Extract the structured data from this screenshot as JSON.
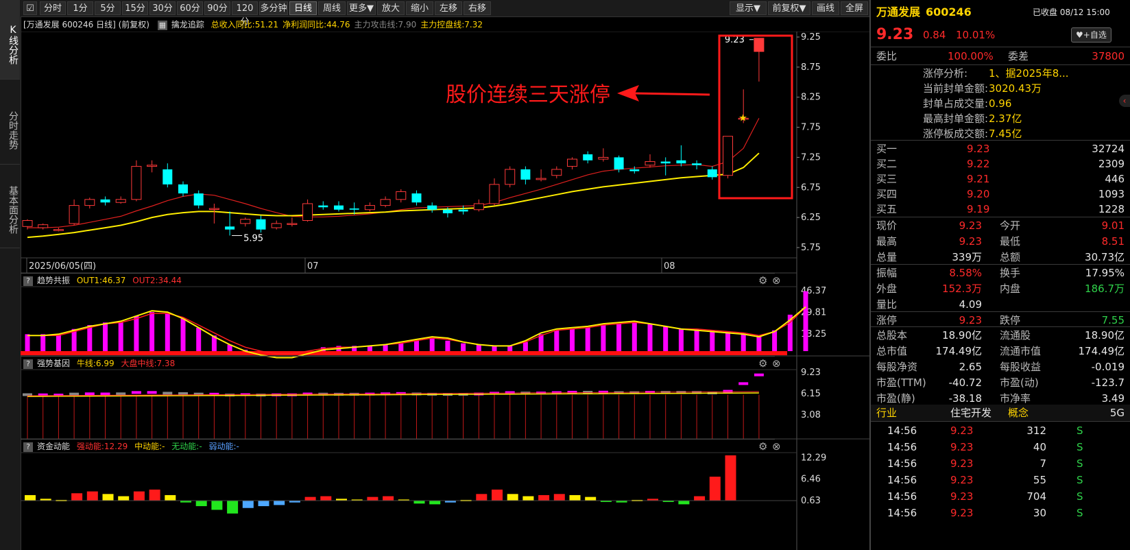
{
  "left_tabs": [
    "K线分析",
    "分时走势",
    "基本面分析"
  ],
  "toolbar": {
    "left_buttons": [
      "分时",
      "1分",
      "5分",
      "15分",
      "30分",
      "60分",
      "90分",
      "120分",
      "多分钟",
      "日线",
      "周线",
      "更多▼",
      "放大",
      "缩小",
      "左移",
      "右移"
    ],
    "active": "日线",
    "right_buttons": [
      "显示▼",
      "前复权▼",
      "画线",
      "全屏"
    ]
  },
  "info": {
    "title": "[万通发展 600246 日线] (前复权)",
    "indicator": "擒龙追踪",
    "items": [
      {
        "text": "总收入同比:51.21",
        "color": "#ffd400"
      },
      {
        "text": "净利润同比:44.76",
        "color": "#ffd400"
      },
      {
        "text": "主力攻击线:7.90",
        "color": "#888888"
      },
      {
        "text": "主力控盘线:7.32",
        "color": "#ffd400"
      }
    ]
  },
  "kchart": {
    "price_ticks": [
      "9.25",
      "8.75",
      "8.25",
      "7.75",
      "7.25",
      "6.75",
      "6.25",
      "5.75"
    ],
    "date_labels": [
      "2025/06/05(四)",
      "07",
      "08"
    ],
    "high_label": "9.23",
    "low_label": "5.95",
    "annotation": "股价连续三天涨停",
    "candles": [
      {
        "o": 6.1,
        "c": 6.2,
        "h": 6.22,
        "l": 6.05
      },
      {
        "o": 6.08,
        "c": 6.13,
        "h": 6.15,
        "l": 6.05
      },
      {
        "o": 6.05,
        "c": 6.05,
        "h": 6.08,
        "l": 6.02
      },
      {
        "o": 6.15,
        "c": 6.45,
        "h": 6.55,
        "l": 6.12
      },
      {
        "o": 6.45,
        "c": 6.55,
        "h": 6.58,
        "l": 6.4
      },
      {
        "o": 6.55,
        "c": 6.5,
        "h": 6.6,
        "l": 6.45
      },
      {
        "o": 6.5,
        "c": 6.55,
        "h": 6.6,
        "l": 6.48
      },
      {
        "o": 6.55,
        "c": 7.1,
        "h": 7.2,
        "l": 6.52
      },
      {
        "o": 7.1,
        "c": 7.12,
        "h": 7.2,
        "l": 7.0
      },
      {
        "o": 7.05,
        "c": 6.8,
        "h": 7.15,
        "l": 6.75
      },
      {
        "o": 6.8,
        "c": 6.65,
        "h": 6.85,
        "l": 6.6
      },
      {
        "o": 6.65,
        "c": 6.45,
        "h": 6.7,
        "l": 6.4
      },
      {
        "o": 6.4,
        "c": 6.4,
        "h": 6.48,
        "l": 6.15
      },
      {
        "o": 6.1,
        "c": 6.05,
        "h": 6.35,
        "l": 5.95
      },
      {
        "o": 6.15,
        "c": 6.22,
        "h": 6.25,
        "l": 6.1
      },
      {
        "o": 6.22,
        "c": 6.05,
        "h": 6.28,
        "l": 6.0
      },
      {
        "o": 6.08,
        "c": 6.15,
        "h": 6.2,
        "l": 6.05
      },
      {
        "o": 6.15,
        "c": 6.15,
        "h": 6.25,
        "l": 6.1
      },
      {
        "o": 6.2,
        "c": 6.48,
        "h": 6.55,
        "l": 6.18
      },
      {
        "o": 6.45,
        "c": 6.42,
        "h": 6.52,
        "l": 6.38
      },
      {
        "o": 6.45,
        "c": 6.38,
        "h": 6.52,
        "l": 6.35
      },
      {
        "o": 6.4,
        "c": 6.38,
        "h": 6.5,
        "l": 6.3
      },
      {
        "o": 6.38,
        "c": 6.45,
        "h": 6.5,
        "l": 6.35
      },
      {
        "o": 6.45,
        "c": 6.55,
        "h": 6.6,
        "l": 6.42
      },
      {
        "o": 6.55,
        "c": 6.68,
        "h": 6.72,
        "l": 6.5
      },
      {
        "o": 6.65,
        "c": 6.5,
        "h": 6.7,
        "l": 6.45
      },
      {
        "o": 6.45,
        "c": 6.38,
        "h": 6.5,
        "l": 6.33
      },
      {
        "o": 6.38,
        "c": 6.32,
        "h": 6.42,
        "l": 6.25
      },
      {
        "o": 6.38,
        "c": 6.35,
        "h": 6.45,
        "l": 6.3
      },
      {
        "o": 6.38,
        "c": 6.48,
        "h": 6.55,
        "l": 6.35
      },
      {
        "o": 6.48,
        "c": 6.8,
        "h": 6.9,
        "l": 6.45
      },
      {
        "o": 6.8,
        "c": 7.05,
        "h": 7.1,
        "l": 6.75
      },
      {
        "o": 7.05,
        "c": 6.88,
        "h": 7.1,
        "l": 6.8
      },
      {
        "o": 6.88,
        "c": 6.9,
        "h": 7.05,
        "l": 6.85
      },
      {
        "o": 6.95,
        "c": 7.05,
        "h": 7.1,
        "l": 6.9
      },
      {
        "o": 7.1,
        "c": 7.22,
        "h": 7.25,
        "l": 7.05
      },
      {
        "o": 7.3,
        "c": 7.2,
        "h": 7.35,
        "l": 7.15
      },
      {
        "o": 7.22,
        "c": 7.25,
        "h": 7.4,
        "l": 7.18
      },
      {
        "o": 7.25,
        "c": 7.05,
        "h": 7.28,
        "l": 7.0
      },
      {
        "o": 7.05,
        "c": 7.02,
        "h": 7.1,
        "l": 6.98
      },
      {
        "o": 7.12,
        "c": 7.18,
        "h": 7.3,
        "l": 7.08
      },
      {
        "o": 7.18,
        "c": 7.15,
        "h": 7.25,
        "l": 6.95
      },
      {
        "o": 7.2,
        "c": 7.15,
        "h": 7.45,
        "l": 7.1
      },
      {
        "o": 7.15,
        "c": 7.12,
        "h": 7.2,
        "l": 7.05
      },
      {
        "o": 7.05,
        "c": 6.92,
        "h": 7.1,
        "l": 6.88
      },
      {
        "o": 6.95,
        "c": 7.6,
        "h": 7.6,
        "l": 6.9
      },
      {
        "o": 7.9,
        "c": 7.9,
        "h": 8.38,
        "l": 7.82
      },
      {
        "o": 9.01,
        "c": 9.23,
        "h": 9.23,
        "l": 8.51
      }
    ],
    "ma_red": [
      6.08,
      6.08,
      6.09,
      6.12,
      6.17,
      6.22,
      6.27,
      6.36,
      6.44,
      6.53,
      6.6,
      6.64,
      6.62,
      6.55,
      6.48,
      6.4,
      6.33,
      6.27,
      6.26,
      6.26,
      6.27,
      6.29,
      6.31,
      6.34,
      6.38,
      6.41,
      6.42,
      6.43,
      6.44,
      6.45,
      6.5,
      6.58,
      6.65,
      6.72,
      6.8,
      6.88,
      6.96,
      7.02,
      7.05,
      7.07,
      7.09,
      7.11,
      7.12,
      7.13,
      7.1,
      7.18,
      7.4,
      7.9
    ],
    "ma_yellow": [
      5.92,
      5.94,
      5.97,
      6.0,
      6.04,
      6.08,
      6.12,
      6.18,
      6.25,
      6.3,
      6.33,
      6.35,
      6.35,
      6.33,
      6.31,
      6.29,
      6.28,
      6.28,
      6.29,
      6.3,
      6.31,
      6.32,
      6.33,
      6.34,
      6.36,
      6.37,
      6.38,
      6.39,
      6.4,
      6.41,
      6.44,
      6.48,
      6.53,
      6.58,
      6.63,
      6.68,
      6.72,
      6.76,
      6.79,
      6.82,
      6.85,
      6.88,
      6.91,
      6.93,
      6.95,
      6.97,
      7.08,
      7.32
    ]
  },
  "panel1": {
    "title": "趋势共振",
    "out1": "OUT1:46.37",
    "out2": "OUT2:34.44",
    "ticks": [
      "46.37",
      "29.81",
      "13.25"
    ],
    "bars": [
      13,
      13,
      13,
      17,
      20,
      22,
      22,
      27,
      30,
      29,
      25,
      18,
      12,
      5,
      1,
      0,
      0,
      0,
      0,
      3,
      4,
      4,
      4,
      5,
      6,
      8,
      10,
      8,
      6,
      5,
      4,
      4,
      7,
      13,
      16,
      17,
      18,
      20,
      21,
      22,
      21,
      19,
      17,
      17,
      16,
      15,
      14,
      12,
      16,
      28,
      46
    ],
    "line_yellow": [
      12,
      12,
      13,
      16,
      19,
      21,
      23,
      27,
      31,
      30,
      25,
      18,
      11,
      5,
      0,
      -3,
      -5,
      -5,
      -2,
      1,
      2,
      3,
      4,
      5,
      7,
      9,
      11,
      10,
      7,
      5,
      4,
      4,
      8,
      14,
      17,
      18,
      19,
      21,
      22,
      23,
      21,
      19,
      17,
      16,
      15,
      14,
      13,
      11,
      15,
      24,
      34
    ],
    "line_red": [
      12,
      12,
      12,
      15,
      18,
      21,
      22,
      25,
      29,
      29,
      26,
      20,
      14,
      8,
      3,
      0,
      -2,
      -2,
      0,
      2,
      3,
      3,
      4,
      5,
      6,
      8,
      10,
      9,
      7,
      5,
      4,
      4,
      7,
      12,
      16,
      17,
      18,
      20,
      21,
      22,
      21,
      19,
      17,
      17,
      16,
      15,
      14,
      12,
      15,
      22,
      34
    ]
  },
  "panel2": {
    "title": "强势基因",
    "niu": "牛线:6.99",
    "dapan": "大盘中线:7.38",
    "ticks": [
      "9.23",
      "6.15",
      "3.08"
    ]
  },
  "panel3": {
    "title": "资金动能",
    "strong": "强动能:12.29",
    "mid": "中动能:-",
    "none": "无动能:-",
    "weak": "弱动能:-",
    "ticks": [
      "12.29",
      "6.46",
      "0.63"
    ],
    "bars": [
      1.5,
      0.5,
      0.2,
      2.0,
      2.5,
      1.8,
      1.2,
      2.5,
      3.0,
      1.5,
      -0.5,
      -1.5,
      -2.5,
      -3.5,
      -2.0,
      -1.5,
      -1.2,
      -0.5,
      1.0,
      1.2,
      0.5,
      0.3,
      1.0,
      1.2,
      0.3,
      -0.8,
      -1.0,
      -0.5,
      0.2,
      1.8,
      3.0,
      1.8,
      1.2,
      1.5,
      1.8,
      1.5,
      1.0,
      -0.3,
      -0.5,
      0.2,
      0.5,
      -0.3,
      -1.0,
      1.2,
      6.5,
      12.29
    ],
    "bar_colors": [
      "y",
      "y",
      "y",
      "r",
      "r",
      "y",
      "y",
      "r",
      "r",
      "y",
      "g",
      "g",
      "g",
      "g",
      "b",
      "b",
      "b",
      "b",
      "r",
      "r",
      "y",
      "y",
      "r",
      "r",
      "y",
      "g",
      "g",
      "b",
      "y",
      "r",
      "r",
      "y",
      "y",
      "r",
      "r",
      "y",
      "y",
      "g",
      "g",
      "y",
      "r",
      "g",
      "g",
      "r",
      "r",
      "r"
    ]
  },
  "quote": {
    "name": "万通发展",
    "code": "600246",
    "status": "已收盘 08/12 15:00",
    "price": "9.23",
    "change": "0.84",
    "pct": "10.01%",
    "watch_btn": "+自选",
    "weibi_label": "委比",
    "weibi": "100.00%",
    "weicha_label": "委差",
    "weicha": "37800",
    "limit_analysis": [
      {
        "label": "涨停分析:",
        "value": "1、据2025年8..."
      },
      {
        "label": "当前封单金额:",
        "value": "3020.43万"
      },
      {
        "label": "封单占成交量:",
        "value": "0.96"
      },
      {
        "label": "最高封单金额:",
        "value": "2.37亿"
      },
      {
        "label": "涨停板成交额:",
        "value": "7.45亿"
      }
    ],
    "bids": [
      {
        "label": "买一",
        "price": "9.23",
        "vol": "32724"
      },
      {
        "label": "买二",
        "price": "9.22",
        "vol": "2309"
      },
      {
        "label": "买三",
        "price": "9.21",
        "vol": "446"
      },
      {
        "label": "买四",
        "price": "9.20",
        "vol": "1093"
      },
      {
        "label": "买五",
        "price": "9.19",
        "vol": "1228"
      }
    ],
    "stats": [
      {
        "l1": "现价",
        "v1": "9.23",
        "c1": "red",
        "l2": "今开",
        "v2": "9.01",
        "c2": "red"
      },
      {
        "l1": "最高",
        "v1": "9.23",
        "c1": "red",
        "l2": "最低",
        "v2": "8.51",
        "c2": "red"
      },
      {
        "l1": "总量",
        "v1": "339万",
        "c1": "wht",
        "l2": "总额",
        "v2": "30.73亿",
        "c2": "wht"
      },
      {
        "l1": "振幅",
        "v1": "8.58%",
        "c1": "red",
        "l2": "换手",
        "v2": "17.95%",
        "c2": "wht"
      },
      {
        "l1": "外盘",
        "v1": "152.3万",
        "c1": "red",
        "l2": "内盘",
        "v2": "186.7万",
        "c2": "grn"
      },
      {
        "l1": "量比",
        "v1": "4.09",
        "c1": "wht",
        "l2": "",
        "v2": "",
        "c2": "wht"
      },
      {
        "l1": "涨停",
        "v1": "9.23",
        "c1": "red",
        "l2": "跌停",
        "v2": "7.55",
        "c2": "grn"
      },
      {
        "l1": "总股本",
        "v1": "18.90亿",
        "c1": "wht",
        "l2": "流通股",
        "v2": "18.90亿",
        "c2": "wht"
      },
      {
        "l1": "总市值",
        "v1": "174.49亿",
        "c1": "wht",
        "l2": "流通市值",
        "v2": "174.49亿",
        "c2": "wht"
      },
      {
        "l1": "每股净资",
        "v1": "2.65",
        "c1": "wht",
        "l2": "每股收益",
        "v2": "-0.019",
        "c2": "wht"
      },
      {
        "l1": "市盈(TTM)",
        "v1": "-40.72",
        "c1": "wht",
        "l2": "市盈(动)",
        "v2": "-123.7",
        "c2": "wht"
      },
      {
        "l1": "市盈(静)",
        "v1": "-38.18",
        "c1": "wht",
        "l2": "市净率",
        "v2": "3.49",
        "c2": "wht"
      }
    ],
    "industry_label": "行业",
    "industry": "住宅开发",
    "concept_label": "概念",
    "concept": "5G",
    "trades": [
      {
        "time": "14:56",
        "price": "9.23",
        "vol": "312",
        "side": "S"
      },
      {
        "time": "14:56",
        "price": "9.23",
        "vol": "40",
        "side": "S"
      },
      {
        "time": "14:56",
        "price": "9.23",
        "vol": "7",
        "side": "S"
      },
      {
        "time": "14:56",
        "price": "9.23",
        "vol": "55",
        "side": "S"
      },
      {
        "time": "14:56",
        "price": "9.23",
        "vol": "704",
        "side": "S"
      },
      {
        "time": "14:56",
        "price": "9.23",
        "vol": "30",
        "side": "S"
      }
    ]
  }
}
